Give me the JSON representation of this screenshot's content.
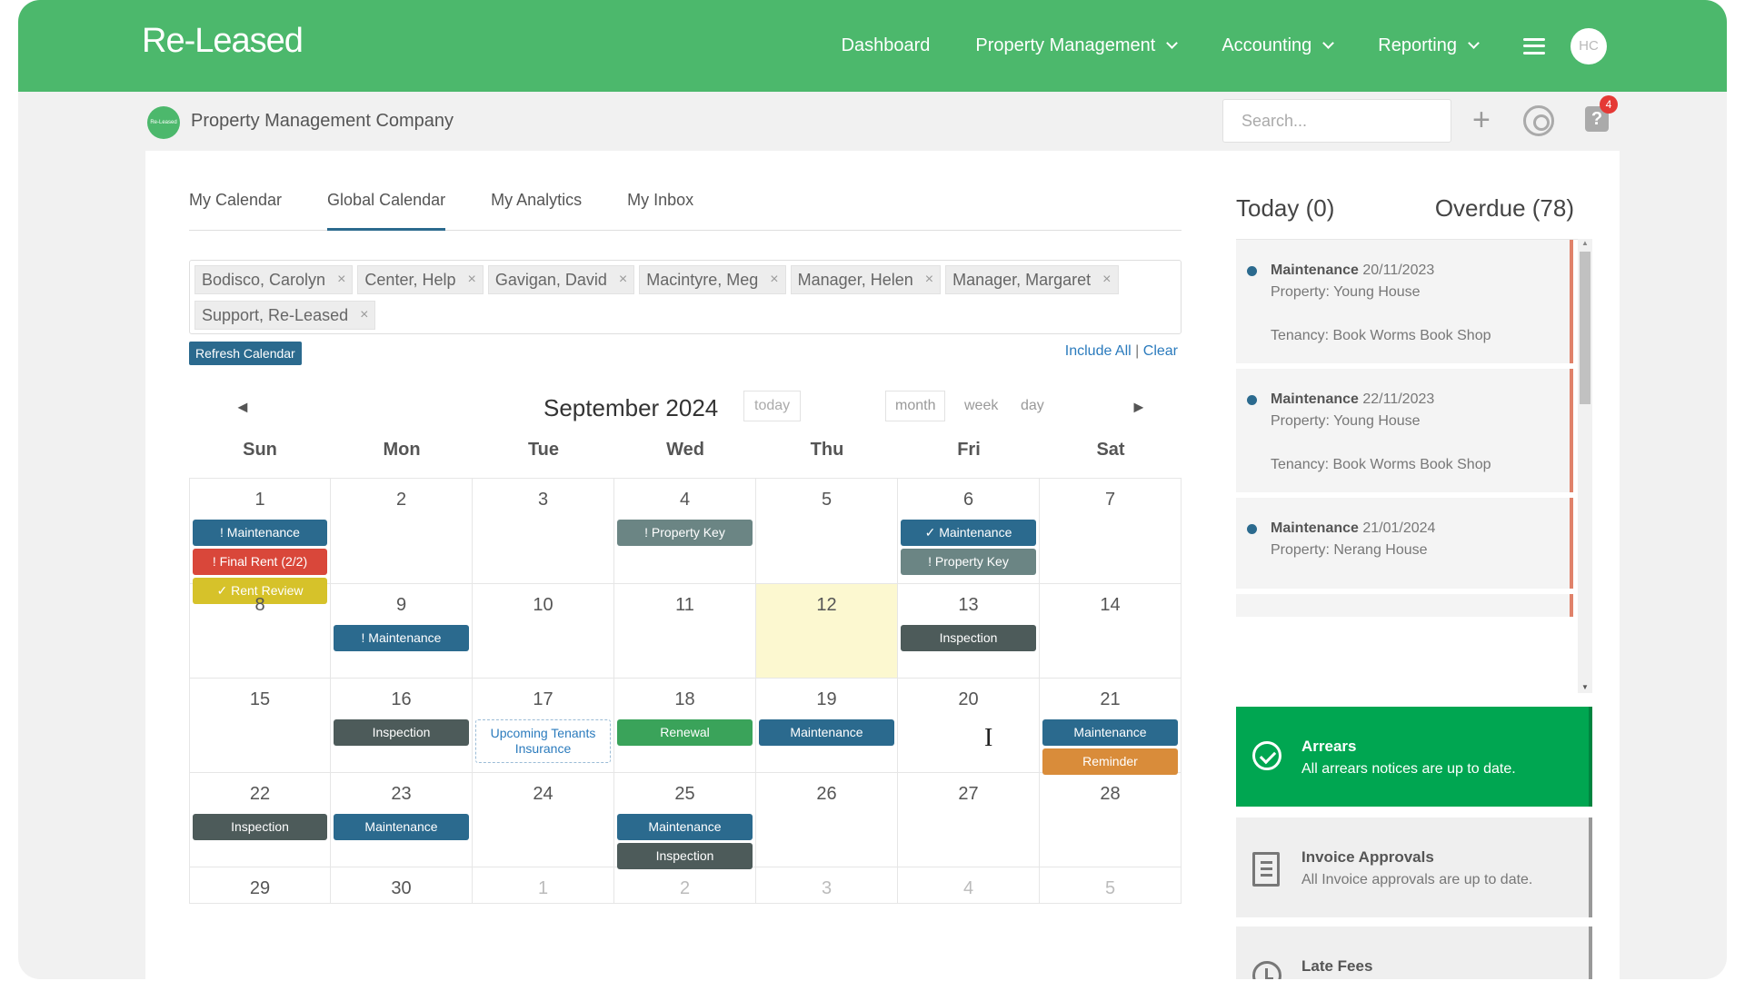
{
  "app": {
    "logo": "Re-Leased"
  },
  "nav": {
    "items": [
      {
        "label": "Dashboard",
        "dropdown": false
      },
      {
        "label": "Property Management",
        "dropdown": true
      },
      {
        "label": "Accounting",
        "dropdown": true
      },
      {
        "label": "Reporting",
        "dropdown": true
      }
    ],
    "avatar_initials": "HC"
  },
  "subheader": {
    "company_logo_text": "Re-Leased",
    "company_name": "Property Management Company",
    "search_placeholder": "Search...",
    "notification_count": "4"
  },
  "tabs": [
    {
      "label": "My Calendar",
      "active": false
    },
    {
      "label": "Global Calendar",
      "active": true
    },
    {
      "label": "My Analytics",
      "active": false
    },
    {
      "label": "My Inbox",
      "active": false
    }
  ],
  "filters": {
    "chips": [
      "Bodisco, Carolyn",
      "Center, Help",
      "Gavigan, David",
      "Macintyre, Meg",
      "Manager, Helen",
      "Manager, Margaret",
      "Support, Re-Leased"
    ],
    "chip_remove": "×",
    "refresh_label": "Refresh Calendar",
    "include_all": "Include All",
    "separator": "|",
    "clear": "Clear"
  },
  "calendar": {
    "title": "September 2024",
    "today_label": "today",
    "views": [
      {
        "label": "month",
        "active": true
      },
      {
        "label": "week",
        "active": false
      },
      {
        "label": "day",
        "active": false
      }
    ],
    "prev": "◄",
    "next": "►",
    "weekdays": [
      "Sun",
      "Mon",
      "Tue",
      "Wed",
      "Thu",
      "Fri",
      "Sat"
    ],
    "weeks": [
      [
        {
          "day": "1",
          "events": [
            {
              "label": "! Maintenance",
              "color": "#2b6a8e"
            },
            {
              "label": "! Final Rent (2/2)",
              "color": "#d9473a"
            },
            {
              "label": "✓ Rent Review",
              "color": "#d6c22a"
            }
          ]
        },
        {
          "day": "2",
          "events": []
        },
        {
          "day": "3",
          "events": []
        },
        {
          "day": "4",
          "events": [
            {
              "label": "! Property Key",
              "color": "#6b8584"
            }
          ]
        },
        {
          "day": "5",
          "events": []
        },
        {
          "day": "6",
          "events": [
            {
              "label": "✓ Maintenance",
              "color": "#2b6a8e"
            },
            {
              "label": "! Property Key",
              "color": "#6b8584"
            }
          ]
        },
        {
          "day": "7",
          "events": []
        }
      ],
      [
        {
          "day": "8",
          "events": []
        },
        {
          "day": "9",
          "events": [
            {
              "label": "! Maintenance",
              "color": "#2b6a8e"
            }
          ]
        },
        {
          "day": "10",
          "events": []
        },
        {
          "day": "11",
          "events": []
        },
        {
          "day": "12",
          "events": [],
          "today": true
        },
        {
          "day": "13",
          "events": [
            {
              "label": "Inspection",
              "color": "#4d5b5a"
            }
          ]
        },
        {
          "day": "14",
          "events": []
        }
      ],
      [
        {
          "day": "15",
          "events": []
        },
        {
          "day": "16",
          "events": [
            {
              "label": "Inspection",
              "color": "#4d5b5a"
            }
          ]
        },
        {
          "day": "17",
          "events": [
            {
              "label": "Upcoming Tenants Insurance",
              "style": "dashed"
            }
          ]
        },
        {
          "day": "18",
          "events": [
            {
              "label": "Renewal",
              "color": "#3aa35a"
            }
          ]
        },
        {
          "day": "19",
          "events": [
            {
              "label": "Maintenance",
              "color": "#2b6a8e"
            }
          ]
        },
        {
          "day": "20",
          "events": []
        },
        {
          "day": "21",
          "events": [
            {
              "label": "Maintenance",
              "color": "#2b6a8e"
            },
            {
              "label": "Reminder",
              "color": "#d98c3a"
            }
          ]
        }
      ],
      [
        {
          "day": "22",
          "events": [
            {
              "label": "Inspection",
              "color": "#4d5b5a"
            }
          ]
        },
        {
          "day": "23",
          "events": [
            {
              "label": "Maintenance",
              "color": "#2b6a8e"
            }
          ]
        },
        {
          "day": "24",
          "events": []
        },
        {
          "day": "25",
          "events": [
            {
              "label": "Maintenance",
              "color": "#2b6a8e"
            },
            {
              "label": "Inspection",
              "color": "#4d5b5a"
            }
          ]
        },
        {
          "day": "26",
          "events": []
        },
        {
          "day": "27",
          "events": []
        },
        {
          "day": "28",
          "events": []
        }
      ],
      [
        {
          "day": "29",
          "events": []
        },
        {
          "day": "30",
          "events": []
        },
        {
          "day": "1",
          "events": [],
          "other": true
        },
        {
          "day": "2",
          "events": [],
          "other": true
        },
        {
          "day": "3",
          "events": [],
          "other": true
        },
        {
          "day": "4",
          "events": [],
          "other": true
        },
        {
          "day": "5",
          "events": [],
          "other": true
        }
      ]
    ]
  },
  "tasks": {
    "today_label": "Today (0)",
    "overdue_label": "Overdue (78)",
    "items": [
      {
        "type": "Maintenance",
        "date": "20/11/2023",
        "property": "Property: Young House",
        "tenancy": "Tenancy: Book Worms Book Shop"
      },
      {
        "type": "Maintenance",
        "date": "22/11/2023",
        "property": "Property: Young House",
        "tenancy": "Tenancy: Book Worms Book Shop"
      },
      {
        "type": "Maintenance",
        "date": "21/01/2024",
        "property": "Property: Nerang House",
        "tenancy": ""
      }
    ]
  },
  "summaries": {
    "arrears": {
      "title": "Arrears",
      "desc": "All arrears notices are up to date.",
      "icon": "check-circle-icon"
    },
    "invoices": {
      "title": "Invoice Approvals",
      "desc": "All Invoice approvals are up to date.",
      "icon": "document-icon"
    },
    "latefees": {
      "title": "Late Fees",
      "desc": "",
      "icon": "clock-icon"
    }
  }
}
